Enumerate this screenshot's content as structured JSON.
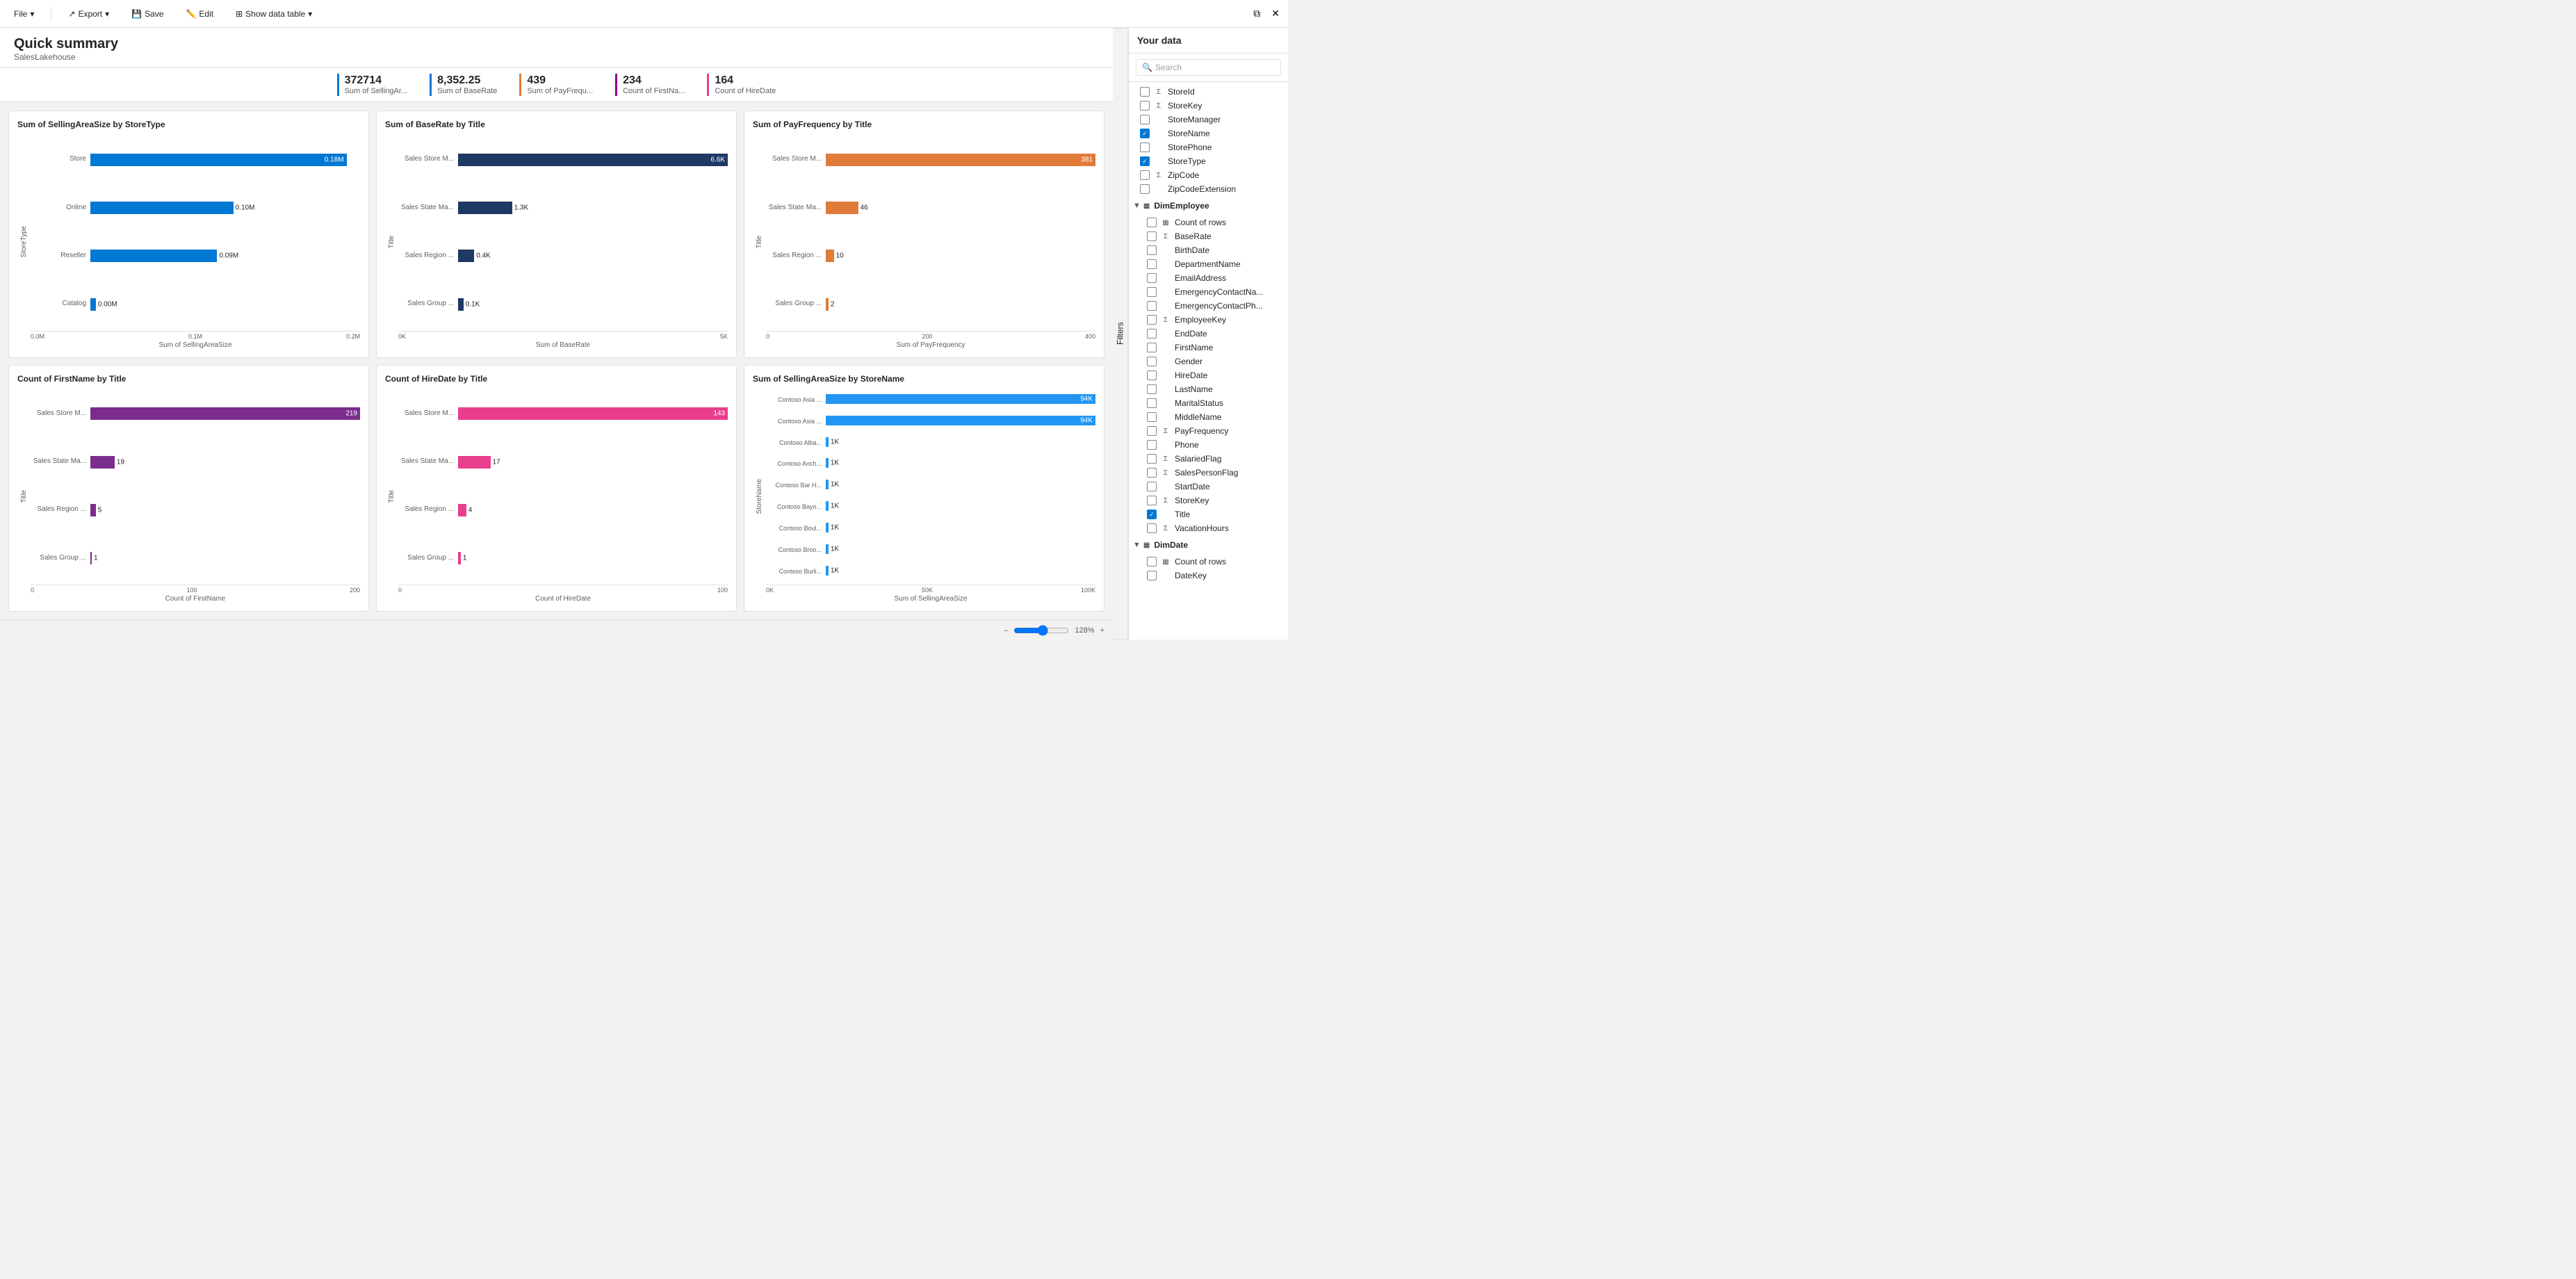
{
  "toolbar": {
    "file_label": "File",
    "export_label": "Export",
    "save_label": "Save",
    "edit_label": "Edit",
    "show_data_table_label": "Show data table"
  },
  "header": {
    "title": "Quick summary",
    "subtitle": "SalesLakehouse"
  },
  "kpis": [
    {
      "value": "372714",
      "label": "Sum of SellingAr...",
      "color": "#0078d4"
    },
    {
      "value": "8,352.25",
      "label": "Sum of BaseRate",
      "color": "#0078d4"
    },
    {
      "value": "439",
      "label": "Sum of PayFrequ...",
      "color": "#e07b39"
    },
    {
      "value": "234",
      "label": "Count of FirstNa...",
      "color": "#8b008b"
    },
    {
      "value": "164",
      "label": "Count of HireDate",
      "color": "#e83e8c"
    }
  ],
  "charts": [
    {
      "id": "chart1",
      "title": "Sum of SellingAreaSize by StoreType",
      "y_axis_label": "StoreType",
      "x_axis_label": "Sum of SellingAreaSize",
      "color": "#0078d4",
      "bars": [
        {
          "label": "Store",
          "value": "0.18M",
          "pct": 95
        },
        {
          "label": "Online",
          "value": "0.10M",
          "pct": 53
        },
        {
          "label": "Reseller",
          "value": "0.09M",
          "pct": 47
        },
        {
          "label": "Catalog",
          "value": "0.00M",
          "pct": 2
        }
      ],
      "x_ticks": [
        "0.0M",
        "0.1M",
        "0.2M"
      ]
    },
    {
      "id": "chart2",
      "title": "Sum of BaseRate by Title",
      "y_axis_label": "Title",
      "x_axis_label": "Sum of BaseRate",
      "color": "#1f3864",
      "bars": [
        {
          "label": "Sales Store M...",
          "value": "6.6K",
          "pct": 100
        },
        {
          "label": "Sales State Ma...",
          "value": "1.3K",
          "pct": 20
        },
        {
          "label": "Sales Region ...",
          "value": "0.4K",
          "pct": 6
        },
        {
          "label": "Sales Group ...",
          "value": "0.1K",
          "pct": 2
        }
      ],
      "x_ticks": [
        "0K",
        "5K"
      ]
    },
    {
      "id": "chart3",
      "title": "Sum of PayFrequency by Title",
      "y_axis_label": "Title",
      "x_axis_label": "Sum of PayFrequency",
      "color": "#e07b39",
      "bars": [
        {
          "label": "Sales Store M...",
          "value": "381",
          "pct": 100
        },
        {
          "label": "Sales State Ma...",
          "value": "46",
          "pct": 12
        },
        {
          "label": "Sales Region ...",
          "value": "10",
          "pct": 3
        },
        {
          "label": "Sales Group ...",
          "value": "2",
          "pct": 1
        }
      ],
      "x_ticks": [
        "0",
        "200",
        "400"
      ]
    },
    {
      "id": "chart4",
      "title": "Count of FirstName by Title",
      "y_axis_label": "Title",
      "x_axis_label": "Count of FirstName",
      "color": "#7b2d8b",
      "bars": [
        {
          "label": "Sales Store M...",
          "value": "219",
          "pct": 100
        },
        {
          "label": "Sales State Ma...",
          "value": "19",
          "pct": 9
        },
        {
          "label": "Sales Region ...",
          "value": "5",
          "pct": 2
        },
        {
          "label": "Sales Group ...",
          "value": "1",
          "pct": 0.5
        }
      ],
      "x_ticks": [
        "0",
        "100",
        "200"
      ]
    },
    {
      "id": "chart5",
      "title": "Count of HireDate by Title",
      "y_axis_label": "Title",
      "x_axis_label": "Count of HireDate",
      "color": "#e83e8c",
      "bars": [
        {
          "label": "Sales Store M...",
          "value": "143",
          "pct": 100
        },
        {
          "label": "Sales State Ma...",
          "value": "17",
          "pct": 12
        },
        {
          "label": "Sales Region ...",
          "value": "4",
          "pct": 3
        },
        {
          "label": "Sales Group ...",
          "value": "1",
          "pct": 1
        }
      ],
      "x_ticks": [
        "0",
        "100"
      ]
    },
    {
      "id": "chart6",
      "title": "Sum of SellingAreaSize by StoreName",
      "y_axis_label": "StoreName",
      "x_axis_label": "Sum of SellingAreaSize",
      "color": "#2196f3",
      "bars": [
        {
          "label": "Contoso Asia ...",
          "value": "94K",
          "pct": 100
        },
        {
          "label": "Contoso Asia ...",
          "value": "94K",
          "pct": 100
        },
        {
          "label": "Contoso Alba...",
          "value": "1K",
          "pct": 1
        },
        {
          "label": "Contoso Anch...",
          "value": "1K",
          "pct": 1
        },
        {
          "label": "Contoso Bar H...",
          "value": "1K",
          "pct": 1
        },
        {
          "label": "Contoso Bayo...",
          "value": "1K",
          "pct": 1
        },
        {
          "label": "Contoso Boul...",
          "value": "1K",
          "pct": 1
        },
        {
          "label": "Contoso Broo...",
          "value": "1K",
          "pct": 1
        },
        {
          "label": "Contoso Burli...",
          "value": "1K",
          "pct": 1
        }
      ],
      "x_ticks": [
        "0K",
        "50K",
        "100K"
      ]
    }
  ],
  "sidebar": {
    "title": "Your data",
    "search_placeholder": "Search",
    "filters_label": "Filters",
    "items": [
      {
        "type": "item",
        "label": "StoreId",
        "icon": "Σ",
        "checked": false,
        "indent": 1
      },
      {
        "type": "item",
        "label": "StoreKey",
        "icon": "Σ",
        "checked": false,
        "indent": 1
      },
      {
        "type": "item",
        "label": "StoreManager",
        "icon": "",
        "checked": false,
        "indent": 1
      },
      {
        "type": "item",
        "label": "StoreName",
        "icon": "",
        "checked": true,
        "indent": 1
      },
      {
        "type": "item",
        "label": "StorePhone",
        "icon": "",
        "checked": false,
        "indent": 1
      },
      {
        "type": "item",
        "label": "StoreType",
        "icon": "",
        "checked": true,
        "indent": 1
      },
      {
        "type": "item",
        "label": "ZipCode",
        "icon": "Σ",
        "checked": false,
        "indent": 1
      },
      {
        "type": "item",
        "label": "ZipCodeExtension",
        "icon": "",
        "checked": false,
        "indent": 1
      },
      {
        "type": "section",
        "label": "DimEmployee",
        "expanded": true,
        "indent": 0
      },
      {
        "type": "item",
        "label": "Count of rows",
        "icon": "▦",
        "checked": false,
        "indent": 2
      },
      {
        "type": "item",
        "label": "BaseRate",
        "icon": "Σ",
        "checked": false,
        "indent": 2
      },
      {
        "type": "item",
        "label": "BirthDate",
        "icon": "",
        "checked": false,
        "indent": 2
      },
      {
        "type": "item",
        "label": "DepartmentName",
        "icon": "",
        "checked": false,
        "indent": 2
      },
      {
        "type": "item",
        "label": "EmailAddress",
        "icon": "",
        "checked": false,
        "indent": 2
      },
      {
        "type": "item",
        "label": "EmergencyContactNa...",
        "icon": "",
        "checked": false,
        "indent": 2
      },
      {
        "type": "item",
        "label": "EmergencyContactPh...",
        "icon": "",
        "checked": false,
        "indent": 2
      },
      {
        "type": "item",
        "label": "EmployeeKey",
        "icon": "Σ",
        "checked": false,
        "indent": 2
      },
      {
        "type": "item",
        "label": "EndDate",
        "icon": "",
        "checked": false,
        "indent": 2
      },
      {
        "type": "item",
        "label": "FirstName",
        "icon": "",
        "checked": false,
        "indent": 2
      },
      {
        "type": "item",
        "label": "Gender",
        "icon": "",
        "checked": false,
        "indent": 2
      },
      {
        "type": "item",
        "label": "HireDate",
        "icon": "",
        "checked": false,
        "indent": 2
      },
      {
        "type": "item",
        "label": "LastName",
        "icon": "",
        "checked": false,
        "indent": 2
      },
      {
        "type": "item",
        "label": "MaritalStatus",
        "icon": "",
        "checked": false,
        "indent": 2
      },
      {
        "type": "item",
        "label": "MiddleName",
        "icon": "",
        "checked": false,
        "indent": 2
      },
      {
        "type": "item",
        "label": "PayFrequency",
        "icon": "Σ",
        "checked": false,
        "indent": 2
      },
      {
        "type": "item",
        "label": "Phone",
        "icon": "",
        "checked": false,
        "indent": 2
      },
      {
        "type": "item",
        "label": "SalariedFlag",
        "icon": "Σ",
        "checked": false,
        "indent": 2
      },
      {
        "type": "item",
        "label": "SalesPersonFlag",
        "icon": "Σ",
        "checked": false,
        "indent": 2
      },
      {
        "type": "item",
        "label": "StartDate",
        "icon": "",
        "checked": false,
        "indent": 2
      },
      {
        "type": "item",
        "label": "StoreKey",
        "icon": "Σ",
        "checked": false,
        "indent": 2
      },
      {
        "type": "item",
        "label": "Title",
        "icon": "",
        "checked": true,
        "indent": 2
      },
      {
        "type": "item",
        "label": "VacationHours",
        "icon": "Σ",
        "checked": false,
        "indent": 2
      },
      {
        "type": "section",
        "label": "DimDate",
        "expanded": true,
        "indent": 0
      },
      {
        "type": "item",
        "label": "Count of rows",
        "icon": "▦",
        "checked": false,
        "indent": 2
      },
      {
        "type": "item",
        "label": "DateKey",
        "icon": "",
        "checked": false,
        "indent": 2
      }
    ]
  },
  "bottom_bar": {
    "zoom_label": "128%"
  }
}
